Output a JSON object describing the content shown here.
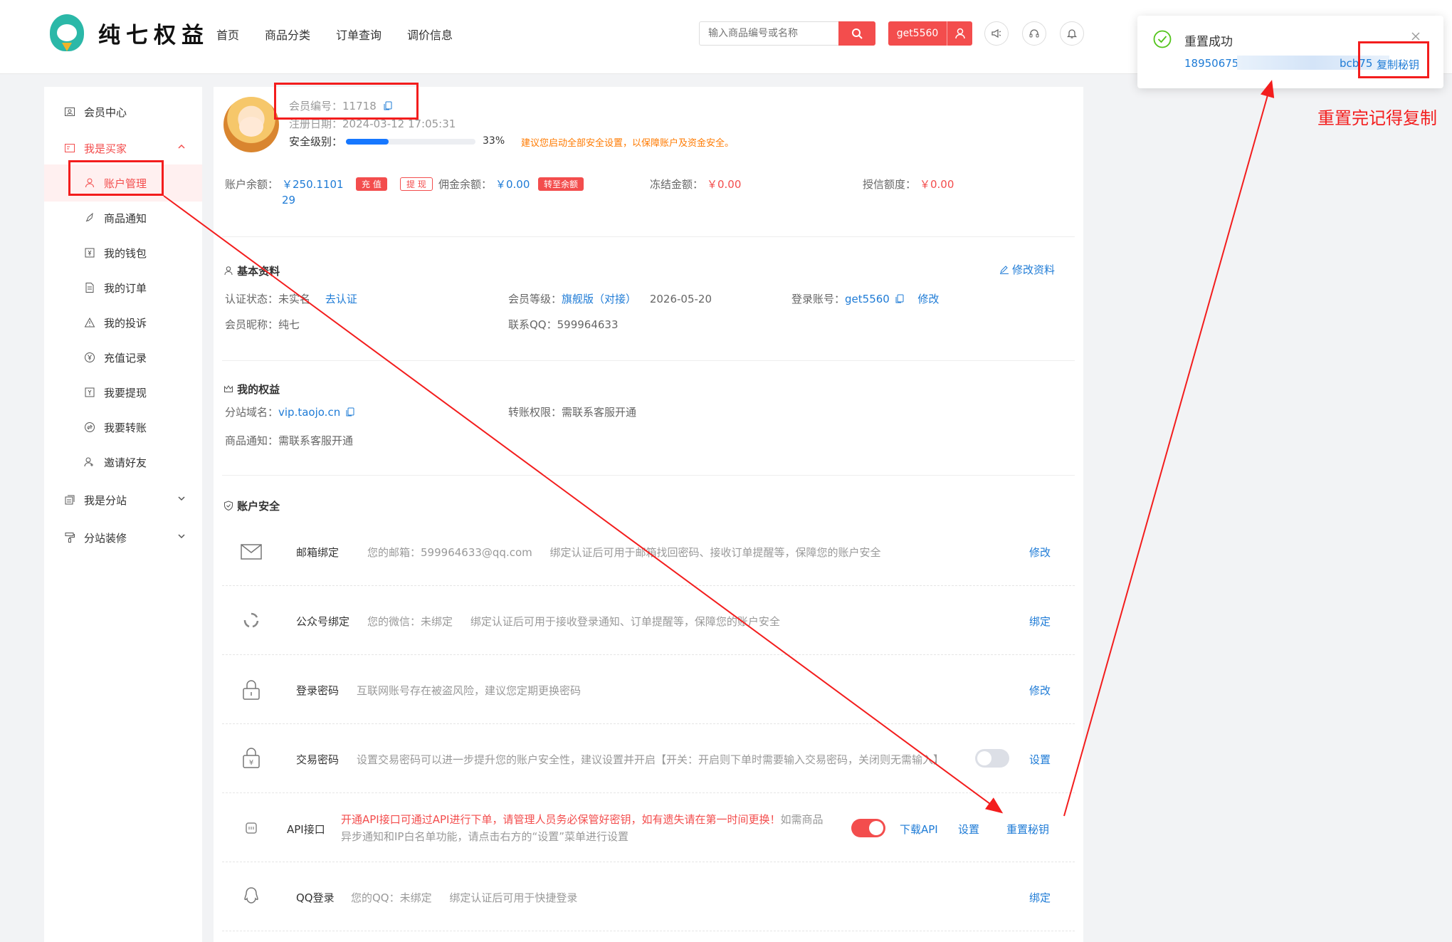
{
  "header": {
    "logo_text": "纯七权益",
    "nav": [
      "首页",
      "商品分类",
      "订单查询",
      "调价信息"
    ],
    "search_placeholder": "输入商品编号或名称",
    "username": "get5560",
    "accent_color": "#f34d4d"
  },
  "sidebar": {
    "member_center": "会员中心",
    "buyer": "我是买家",
    "items": [
      "账户管理",
      "商品通知",
      "我的钱包",
      "我的订单",
      "我的投诉",
      "充值记录",
      "我要提现",
      "我要转账",
      "邀请好友"
    ],
    "substation": "我是分站",
    "decoration": "分站装修"
  },
  "profile": {
    "member_no_label": "会员编号：",
    "member_no": "11718",
    "register_label": "注册日期：",
    "register_date": "2024-03-12 17:05:31",
    "security_label": "安全级别：",
    "security_percent": "33%",
    "security_fraction": 0.33,
    "security_tip": "建议您启动全部安全设置，以保障账户及资金安全。"
  },
  "balance": {
    "account_label": "账户余额：",
    "account_value_line1": "￥250.1101",
    "account_value_line2": "29",
    "recharge": "充 值",
    "withdraw": "提 现",
    "commission_label": "佣金余额：",
    "commission_value": "￥0.00",
    "transfer": "转至余额",
    "frozen_label": "冻结金额：",
    "frozen_value": "￥0.00",
    "credit_label": "授信额度：",
    "credit_value": "￥0.00"
  },
  "basic": {
    "title": "基本资料",
    "edit": "修改资料",
    "auth_label": "认证状态：",
    "auth_value": "未实名",
    "auth_action": "去认证",
    "level_label": "会员等级：",
    "level_value": "旗舰版（对接）",
    "level_date": "2026-05-20",
    "login_label": "登录账号：",
    "login_value": "get5560",
    "login_edit": "修改",
    "nick_label": "会员昵称：",
    "nick_value": "纯七",
    "qq_label": "联系QQ：",
    "qq_value": "599964633"
  },
  "rights": {
    "title": "我的权益",
    "domain_label": "分站域名：",
    "domain_value": "vip.taojo.cn",
    "transfer_label": "转账权限：",
    "transfer_value": "需联系客服开通",
    "notice_label": "商品通知：",
    "notice_value": "需联系客服开通"
  },
  "security": {
    "title": "账户安全",
    "email": {
      "title": "邮箱绑定",
      "label": "您的邮箱：",
      "value": "599964633@qq.com",
      "desc": "绑定认证后可用于邮箱找回密码、接收订单提醒等，保障您的账户安全",
      "action": "修改"
    },
    "wechat": {
      "title": "公众号绑定",
      "label": "您的微信：",
      "value": "未绑定",
      "desc": "绑定认证后可用于接收登录通知、订单提醒等，保障您的账户安全",
      "action": "绑定"
    },
    "password": {
      "title": "登录密码",
      "desc": "互联网账号存在被盗风险，建议您定期更换密码",
      "action": "修改"
    },
    "trade": {
      "title": "交易密码",
      "desc": "设置交易密码可以进一步提升您的账户安全性，建议设置并开启【开关：开启则下单时需要输入交易密码，关闭则无需输入】",
      "action": "设置",
      "enabled": false
    },
    "api": {
      "title": "API接口",
      "warn": "开通API接口可通过API进行下单，请管理人员务必保管好密钥，如有遗失请在第一时间更换！",
      "desc1": "如需商品",
      "desc2": "异步通知和IP白名单功能，请点击右方的“设置”菜单进行设置",
      "enabled": true,
      "download": "下载API",
      "settings": "设置",
      "reset": "重置秘钥"
    },
    "qq": {
      "title": "QQ登录",
      "label": "您的QQ：",
      "value": "未绑定",
      "desc": "绑定认证后可用于快捷登录",
      "action": "绑定"
    }
  },
  "toast": {
    "title": "重置成功",
    "key_start": "18950675",
    "key_end": "bcb75",
    "copy": "复制秘钥",
    "success_color": "#52c41a"
  },
  "annotation": {
    "text": "重置完记得复制",
    "color": "#f31d1d"
  }
}
